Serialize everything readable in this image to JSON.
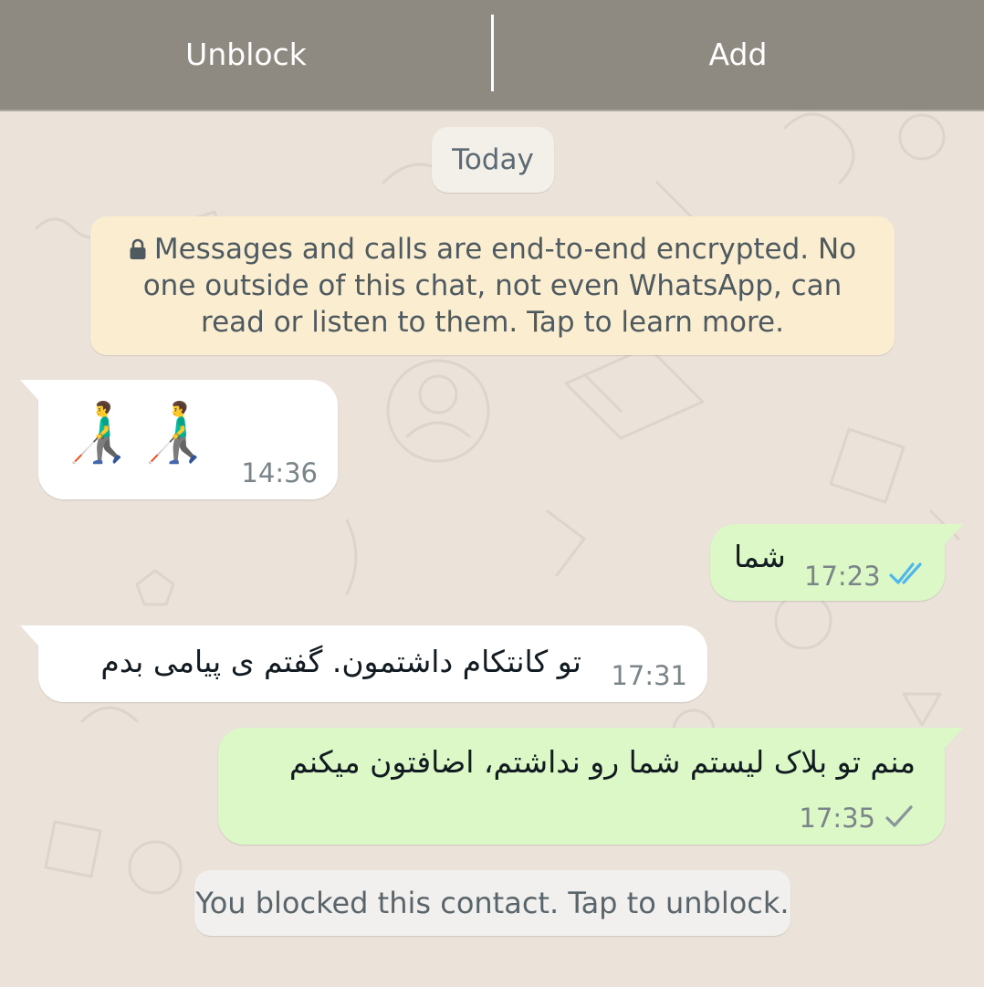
{
  "action_bar": {
    "unblock_label": "Unblock",
    "add_label": "Add"
  },
  "date_pill": "Today",
  "encryption_notice": "Messages and calls are end-to-end encrypted. No one outside of this chat, not even WhatsApp, can read or listen to them. Tap to learn more.",
  "messages": [
    {
      "direction": "incoming",
      "text": "👨‍🦯👨‍🦯",
      "time": "14:36",
      "status": ""
    },
    {
      "direction": "outgoing",
      "text": "شما",
      "time": "17:23",
      "status": "read"
    },
    {
      "direction": "incoming",
      "text": "تو کانتکام داشتمون. گفتم ی پیامی بدم",
      "time": "17:31",
      "status": ""
    },
    {
      "direction": "outgoing",
      "text": "منم تو بلاک لیستم شما رو نداشتم، اضافتون میکنم",
      "time": "17:35",
      "status": "sent"
    }
  ],
  "blocked_notice": "You blocked this contact. Tap to unblock.",
  "colors": {
    "background": "#ebe3da",
    "outgoing_bubble": "#dbf8c6",
    "incoming_bubble": "#ffffff",
    "encryption_notice_bg": "#fbeed0",
    "read_tick": "#4fb6ec",
    "sent_tick": "#8a959b"
  },
  "icons": {
    "lock": "lock-icon",
    "read_receipt": "double-check-icon",
    "sent_receipt": "single-check-icon",
    "emoji": "man-with-white-cane-emoji"
  }
}
